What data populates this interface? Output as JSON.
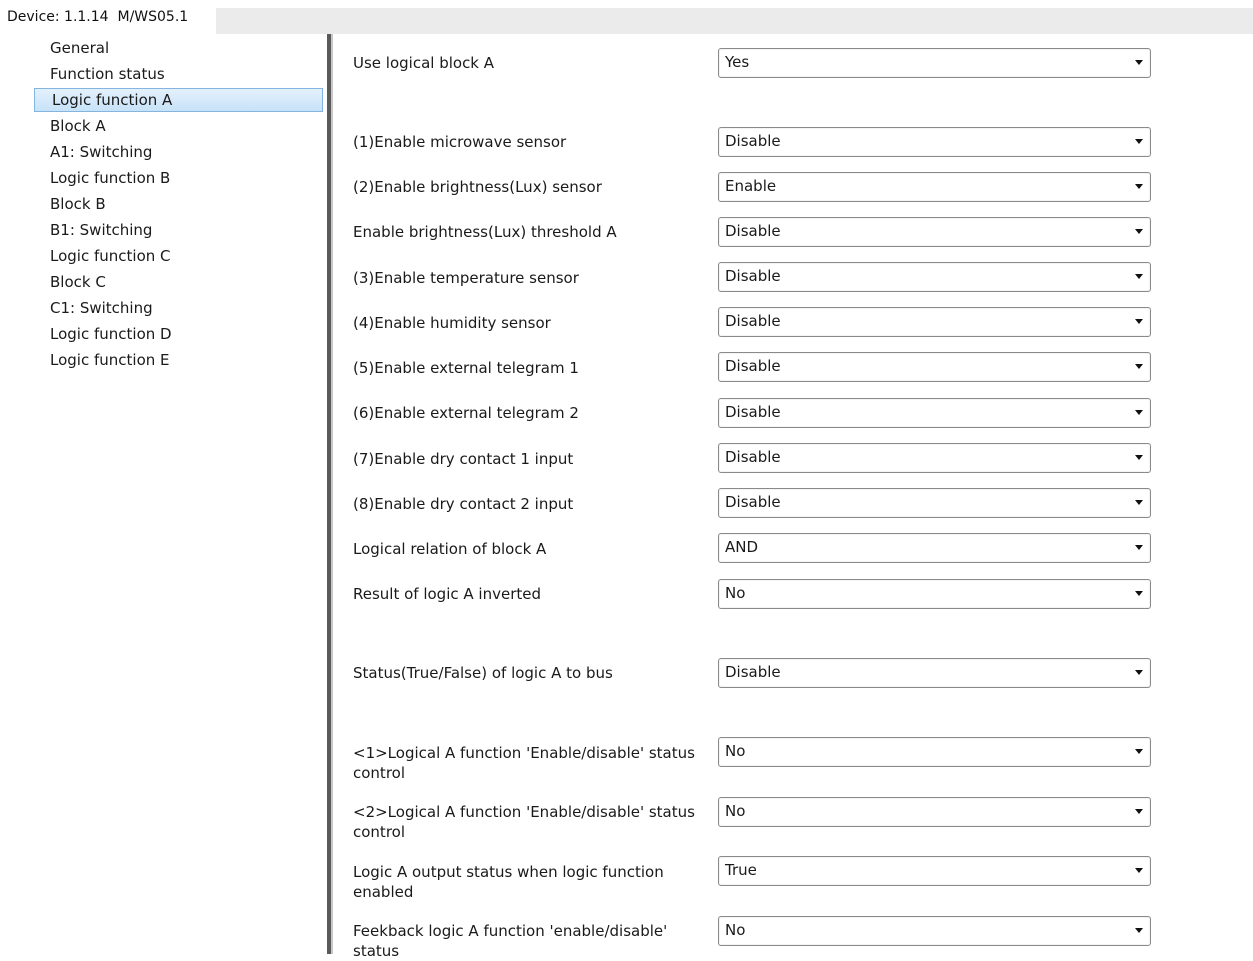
{
  "window": {
    "device_label": "Device: 1.1.14",
    "device_model": "M/WS05.1"
  },
  "sidebar": {
    "items": [
      {
        "label": "General",
        "selected": false
      },
      {
        "label": "Function status",
        "selected": false
      },
      {
        "label": "Logic function A",
        "selected": true
      },
      {
        "label": "Block A",
        "selected": false
      },
      {
        "label": "A1: Switching",
        "selected": false
      },
      {
        "label": "Logic function B",
        "selected": false
      },
      {
        "label": "Block B",
        "selected": false
      },
      {
        "label": "B1: Switching",
        "selected": false
      },
      {
        "label": "Logic function C",
        "selected": false
      },
      {
        "label": "Block C",
        "selected": false
      },
      {
        "label": "C1: Switching",
        "selected": false
      },
      {
        "label": "Logic function D",
        "selected": false
      },
      {
        "label": "Logic function E",
        "selected": false
      }
    ]
  },
  "params": [
    {
      "label": "Use logical block A",
      "value": "Yes"
    },
    {
      "label": "(1)Enable microwave sensor",
      "value": "Disable"
    },
    {
      "label": "(2)Enable brightness(Lux) sensor",
      "value": "Enable"
    },
    {
      "label": "Enable brightness(Lux) threshold A",
      "value": "Disable"
    },
    {
      "label": "(3)Enable temperature sensor",
      "value": "Disable"
    },
    {
      "label": "(4)Enable humidity sensor",
      "value": "Disable"
    },
    {
      "label": "(5)Enable external telegram 1",
      "value": "Disable"
    },
    {
      "label": "(6)Enable external telegram 2",
      "value": "Disable"
    },
    {
      "label": "(7)Enable dry contact 1 input",
      "value": "Disable"
    },
    {
      "label": "(8)Enable dry contact 2 input",
      "value": "Disable"
    },
    {
      "label": "Logical relation of block A",
      "value": "AND"
    },
    {
      "label": "Result of logic A inverted",
      "value": "No"
    },
    {
      "label": "Status(True/False) of logic A to bus",
      "value": "Disable"
    },
    {
      "label": "<1>Logical A function 'Enable/disable' status control",
      "value": "No"
    },
    {
      "label": "<2>Logical A function 'Enable/disable' status control",
      "value": "No"
    },
    {
      "label": "Logic A output status when logic function enabled",
      "value": "True"
    },
    {
      "label": "Feekback logic A function 'enable/disable' status",
      "value": "No"
    }
  ],
  "colors": {
    "selection_bg": "#c7e2f8",
    "selection_border": "#84b5e0",
    "divider": "#5a5a5a"
  }
}
